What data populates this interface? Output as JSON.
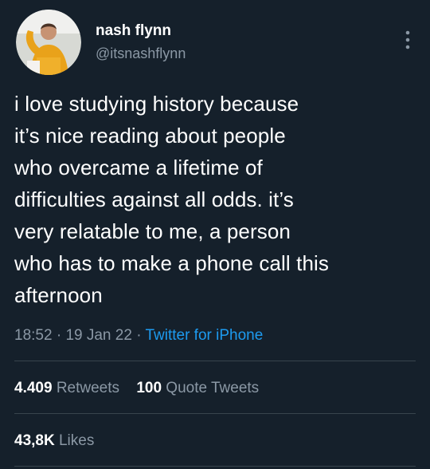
{
  "author": {
    "display_name": "nash flynn",
    "handle": "@itsnashflynn"
  },
  "tweet": {
    "lines": [
      "i love studying history because",
      "it’s nice reading about people",
      "who overcame a lifetime of",
      "difficulties against all odds. it’s",
      "very relatable to me, a person",
      "who has to make a phone call this",
      "afternoon"
    ]
  },
  "meta": {
    "time": "18:52",
    "separator": "·",
    "date": "19 Jan 22",
    "source": "Twitter for iPhone"
  },
  "stats": {
    "retweets_count": "4.409",
    "retweets_label": "Retweets",
    "quotes_count": "100",
    "quotes_label": "Quote Tweets",
    "likes_count": "43,8K",
    "likes_label": "Likes"
  },
  "colors": {
    "background": "#15202b",
    "text": "#ffffff",
    "muted": "#8b98a5",
    "link": "#1d9bf0",
    "divider": "#38444d",
    "avatar_sweater": "#e9a21a"
  },
  "icons": {
    "more": "more-vertical-icon"
  }
}
